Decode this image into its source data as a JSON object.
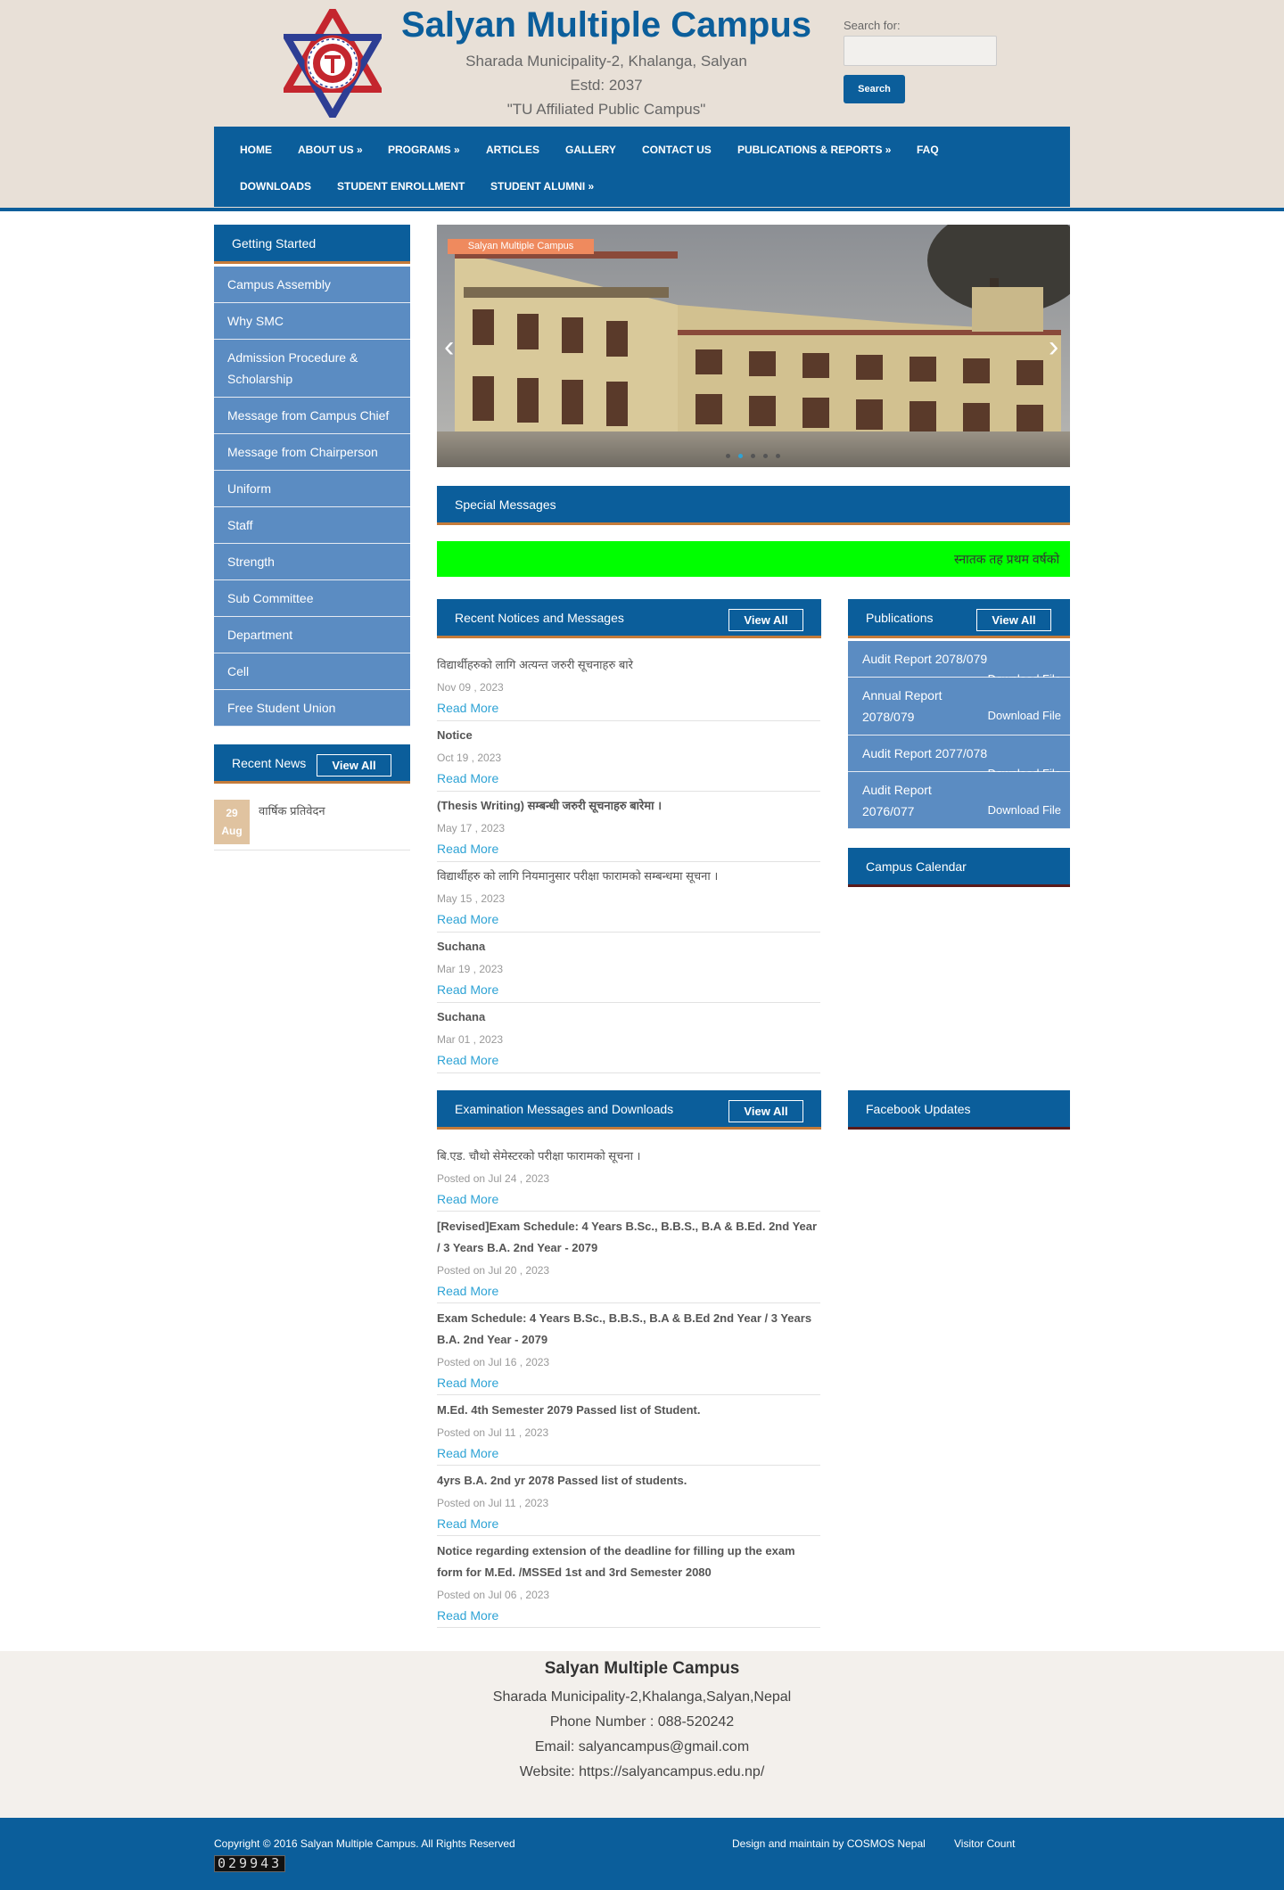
{
  "site": {
    "title": "Salyan Multiple Campus",
    "address": "Sharada Municipality-2, Khalanga, Salyan",
    "established": "Estd: 2037",
    "tagline": "\"TU Affiliated Public Campus\""
  },
  "search": {
    "label": "Search for:",
    "placeholder": "",
    "button": "Search"
  },
  "nav": {
    "items": [
      "HOME",
      "ABOUT US »",
      "PROGRAMS »",
      "ARTICLES",
      "GALLERY",
      "CONTACT US",
      "PUBLICATIONS & REPORTS »",
      "FAQ",
      "DOWNLOADS",
      "STUDENT ENROLLMENT",
      "STUDENT ALUMNI »"
    ]
  },
  "sidebar": {
    "heading": "Getting Started",
    "items": [
      "Campus Assembly",
      "Why SMC",
      "Admission Procedure & Scholarship",
      "Message from Campus Chief",
      "Message from Chairperson",
      "Uniform",
      "Staff",
      "Strength",
      "Sub Committee",
      "Department",
      "Cell",
      "Free Student Union"
    ],
    "recent_news": {
      "heading": "Recent News",
      "view_all": "View All",
      "items": [
        {
          "day": "29",
          "month": "Aug",
          "title": "वार्षिक प्रतिवेदन"
        }
      ]
    }
  },
  "slider": {
    "caption": "Salyan Multiple Campus",
    "prev_icon": "chevron-left",
    "next_icon": "chevron-right",
    "dots": 5,
    "active_dot": 2
  },
  "special_messages": {
    "heading": "Special Messages",
    "marquee": "स्नातक तह प्रथम वर्षको",
    "marquee_bg": "#00ff00"
  },
  "notices": {
    "heading": "Recent Notices and Messages",
    "view_all": "View All",
    "read_more": "Read More",
    "items": [
      {
        "title": "विद्यार्थीहरुको लागि अत्यन्त जरुरी सूचनाहरु बारे",
        "date": "Nov 09 , 2023"
      },
      {
        "title": "Notice",
        "date": "Oct 19 , 2023"
      },
      {
        "title": "(Thesis Writing) सम्बन्धी जरुरी सूचनाहरु बारेमा ।",
        "date": "May 17 , 2023"
      },
      {
        "title": "विद्यार्थीहरु को लागि नियमानुसार परीक्षा फारामको सम्बन्धमा सूचना ।",
        "date": "May 15 , 2023"
      },
      {
        "title": "Suchana",
        "date": "Mar 19 , 2023"
      },
      {
        "title": "Suchana",
        "date": "Mar 01 , 2023"
      }
    ]
  },
  "publications": {
    "heading": "Publications",
    "view_all": "View All",
    "download_label": "Download File",
    "items": [
      "Audit Report 2078/079",
      "Annual Report 2078/079",
      "Audit Report 2077/078",
      "Audit Report 2076/077"
    ]
  },
  "calendar": {
    "heading": "Campus Calendar"
  },
  "exams": {
    "heading": "Examination Messages and Downloads",
    "view_all": "View All",
    "read_more": "Read More",
    "items": [
      {
        "title": "बि.एड. चौथो सेमेस्टरको परीक्षा फारामको सूचना ।",
        "date": "Posted on Jul 24 , 2023"
      },
      {
        "title": "[Revised]Exam Schedule: 4 Years B.Sc., B.B.S., B.A & B.Ed. 2nd Year / 3 Years B.A. 2nd Year - 2079",
        "date": "Posted on Jul 20 , 2023"
      },
      {
        "title": "Exam Schedule: 4 Years B.Sc., B.B.S., B.A & B.Ed 2nd Year / 3 Years B.A. 2nd Year - 2079",
        "date": "Posted on Jul 16 , 2023"
      },
      {
        "title": "M.Ed. 4th Semester 2079 Passed list of Student.",
        "date": "Posted on Jul 11 , 2023"
      },
      {
        "title": "4yrs B.A. 2nd yr 2078 Passed list of students.",
        "date": "Posted on Jul 11 , 2023"
      },
      {
        "title": "Notice regarding extension of the deadline for filling up the exam form for M.Ed. /MSSEd 1st and 3rd Semester 2080",
        "date": "Posted on Jul 06 , 2023"
      }
    ]
  },
  "facebook": {
    "heading": "Facebook Updates"
  },
  "footer": {
    "name": "Salyan Multiple Campus",
    "address": "Sharada Municipality-2,Khalanga,Salyan,Nepal",
    "phone": "Phone Number : 088-520242",
    "email": "Email: salyancampus@gmail.com",
    "website": "Website: https://salyancampus.edu.np/",
    "copyright": "Copyright © 2016 Salyan Multiple Campus. All Rights Reserved",
    "design_prefix": "Design and maintain by",
    "design_link": "COSMOS Nepal",
    "visitor_label": "Visitor Count",
    "visitor_count": "029943"
  },
  "colors": {
    "brand": "#0b5e9b",
    "sidebar": "#5b8cc2",
    "accent": "#c47b3a",
    "link": "#2ea3d5",
    "header_bg": "#e8e0d7"
  }
}
